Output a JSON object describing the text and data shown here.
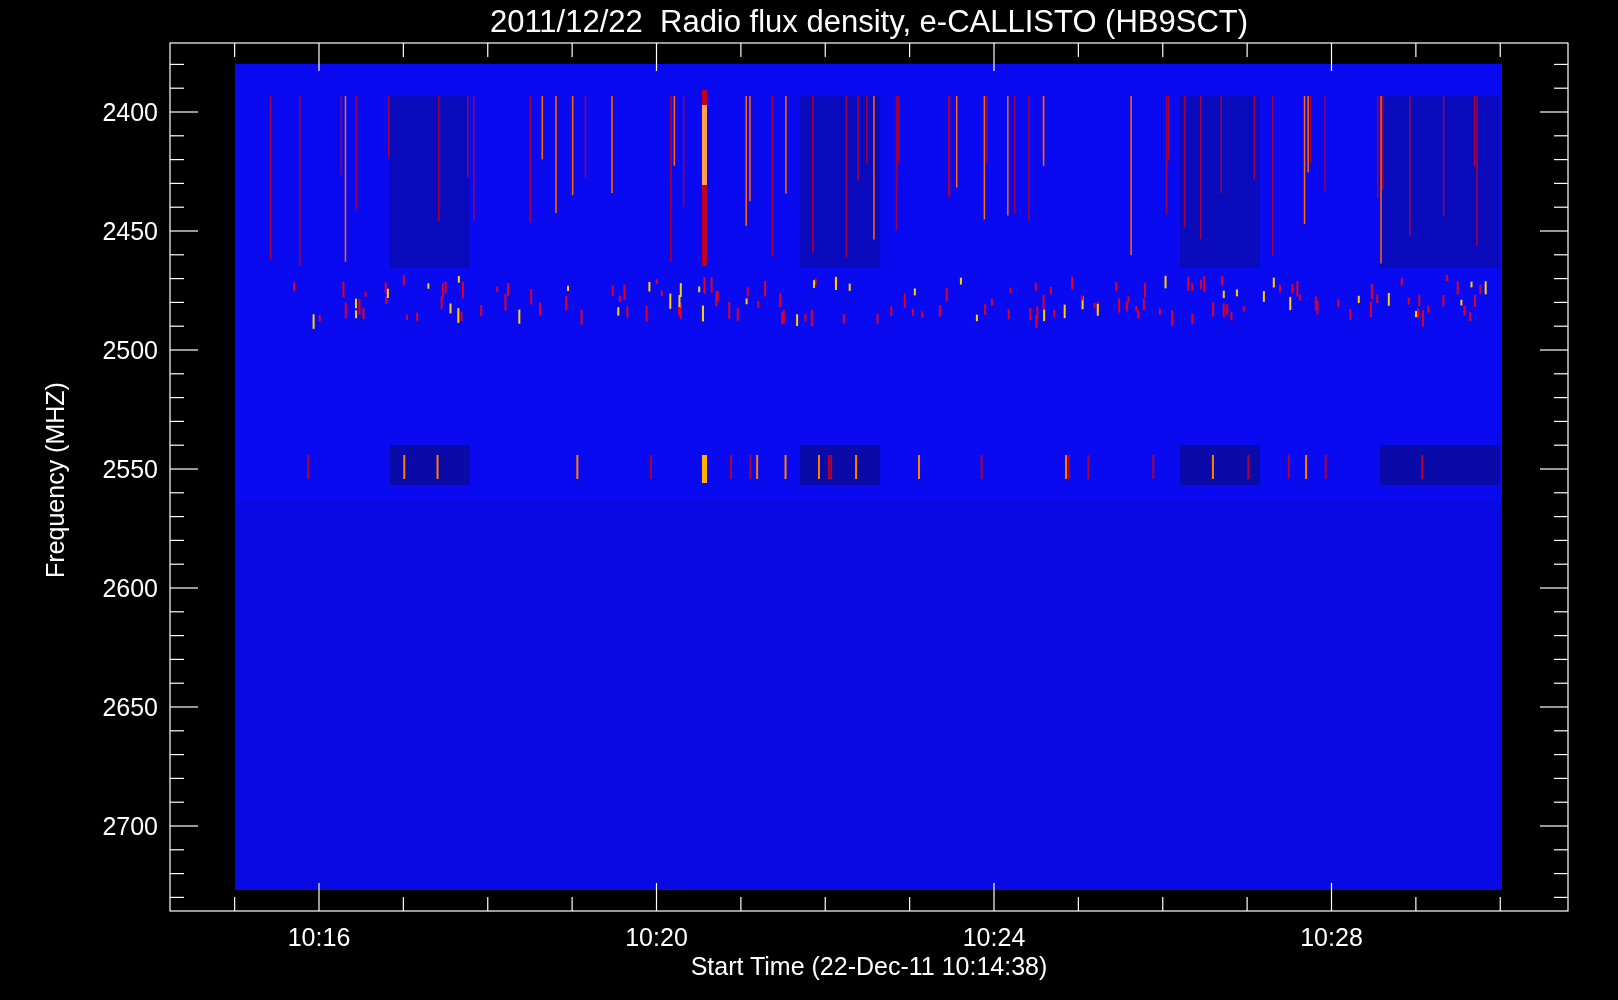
{
  "title": "2011/12/22  Radio flux density, e-CALLISTO (HB9SCT)",
  "y_axis": {
    "label": "Frequency (MHZ)",
    "ticks": [
      "2400",
      "2450",
      "2500",
      "2550",
      "2600",
      "2650",
      "2700"
    ]
  },
  "x_axis": {
    "label": "Start Time (22-Dec-11 10:14:38)",
    "ticks": [
      "10:16",
      "10:20",
      "10:24",
      "10:28"
    ]
  }
}
